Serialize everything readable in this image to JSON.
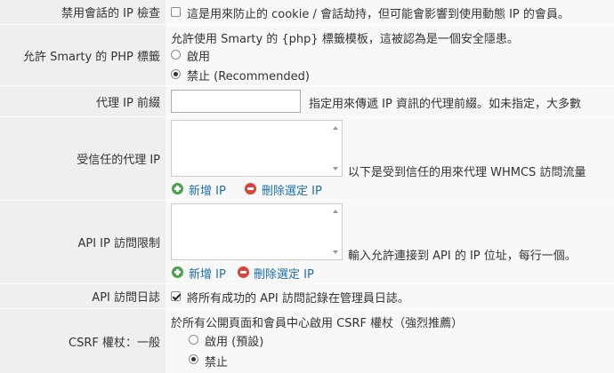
{
  "rows": {
    "ip_check": {
      "label": "禁用會話的 IP 檢查",
      "checkbox_text": "這是用來防止的 cookie / 會話劫持，但可能會影響到使用動態 IP 的會員。",
      "checked": false
    },
    "smarty_php": {
      "label": "允許 Smarty 的 PHP 標籤",
      "description": "允許使用 Smarty 的 {php} 標籤模板，這被認為是一個安全隱患。",
      "options": [
        "啟用",
        "禁止 (Recommended)"
      ],
      "selected": "禁止 (Recommended)"
    },
    "proxy_prefix": {
      "label": "代理 IP 前綴",
      "value": "",
      "help": "指定用來傳遞 IP 資訊的代理前綴。如未指定，大多數"
    },
    "trusted_proxy": {
      "label": "受信任的代理 IP",
      "help": "以下是受到信任的用來代理 WHMCS 訪問流量",
      "add_label": "新增 IP",
      "remove_label": "刪除選定 IP"
    },
    "api_ip": {
      "label": "API IP 訪問限制",
      "help": "輸入允許連接到 API 的 IP 位址，每行一個。",
      "add_label": "新增 IP",
      "remove_label": "刪除選定 IP"
    },
    "api_log": {
      "label": "API 訪問日誌",
      "checkbox_text": "將所有成功的 API 訪問記錄在管理員日誌。",
      "checked": true
    },
    "csrf": {
      "label": "CSRF 權杖：一般",
      "description": "於所有公開頁面和會員中心啟用 CSRF 權杖（強烈推薦）",
      "options": [
        "啟用 (預設)",
        "禁止"
      ],
      "selected": "禁止"
    }
  }
}
